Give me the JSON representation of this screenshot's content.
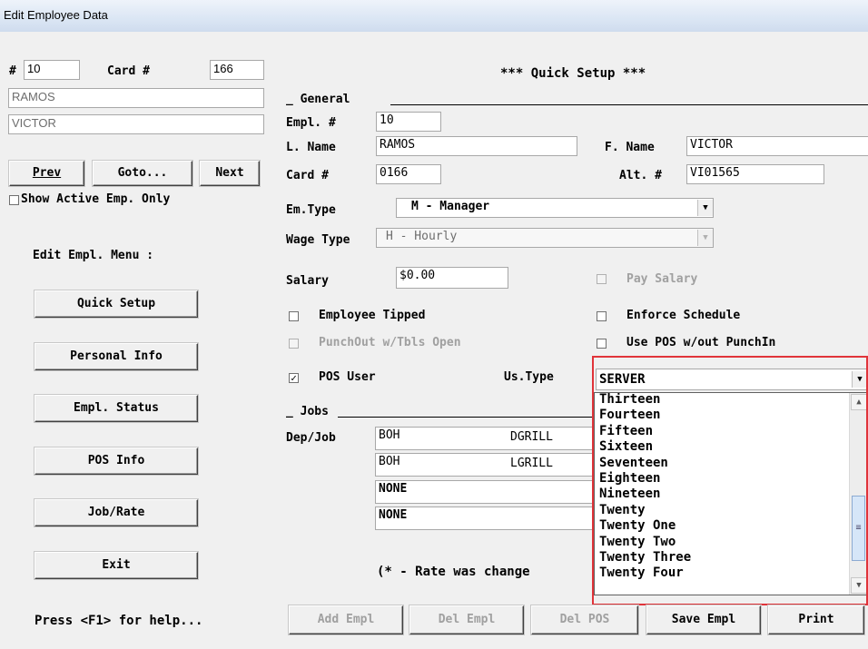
{
  "window": {
    "title": "Edit Employee Data"
  },
  "left": {
    "num_label": "#",
    "num_value": "10",
    "card_label": "Card #",
    "card_value": "166",
    "last_name": "RAMOS",
    "first_name": "VICTOR",
    "nav": {
      "prev": "Prev",
      "goto": "Goto...",
      "next": "Next"
    },
    "show_active": {
      "label": "Show Active Emp. Only",
      "checked": false
    },
    "menu_heading": "Edit Empl. Menu :",
    "menu": [
      "Quick Setup",
      "Personal Info",
      "Empl. Status",
      "POS Info",
      "Job/Rate",
      "Exit"
    ],
    "help": "Press <F1> for help..."
  },
  "main": {
    "heading": "***  Quick Setup  ***",
    "general": {
      "section": "_ General",
      "empl_no_label": "Empl. #",
      "empl_no": "10",
      "lname_label": "L. Name",
      "lname": "RAMOS",
      "fname_label": "F. Name",
      "fname": "VICTOR",
      "card_label": "Card #",
      "card": "0166",
      "alt_label": "Alt. #",
      "alt": "VI01565",
      "emtype_label": "Em.Type",
      "emtype": "M - Manager",
      "wagetype_label": "Wage Type",
      "wagetype": "H - Hourly",
      "salary_label": "Salary",
      "salary": "$0.00",
      "pay_salary": "Pay Salary",
      "employee_tipped": "Employee Tipped",
      "enforce_schedule": "Enforce Schedule",
      "punchout": "PunchOut w/Tbls Open",
      "use_pos": "Use POS w/out PunchIn",
      "pos_user": "POS User",
      "pos_user_checked": true,
      "ustype_label": "Us.Type",
      "ustype": "SERVER"
    },
    "jobs": {
      "section": "_ Jobs",
      "depjob_label": "Dep/Job",
      "rows": [
        {
          "dep": "BOH",
          "job": "DGRILL"
        },
        {
          "dep": "BOH",
          "job": "LGRILL"
        },
        {
          "dep": "NONE",
          "job": ""
        },
        {
          "dep": "NONE",
          "job": ""
        }
      ],
      "rate_note": "(* - Rate was change"
    },
    "dropdown_items": [
      "Thirteen",
      "Fourteen",
      "Fifteen",
      "Sixteen",
      "Seventeen",
      "Eighteen",
      "Nineteen",
      "Twenty",
      "Twenty One",
      "Twenty Two",
      "Twenty Three",
      "Twenty Four"
    ],
    "buttons": {
      "add": "Add Empl",
      "del": "Del Empl",
      "delpos": "Del POS",
      "save": "Save Empl",
      "print": "Print"
    }
  }
}
